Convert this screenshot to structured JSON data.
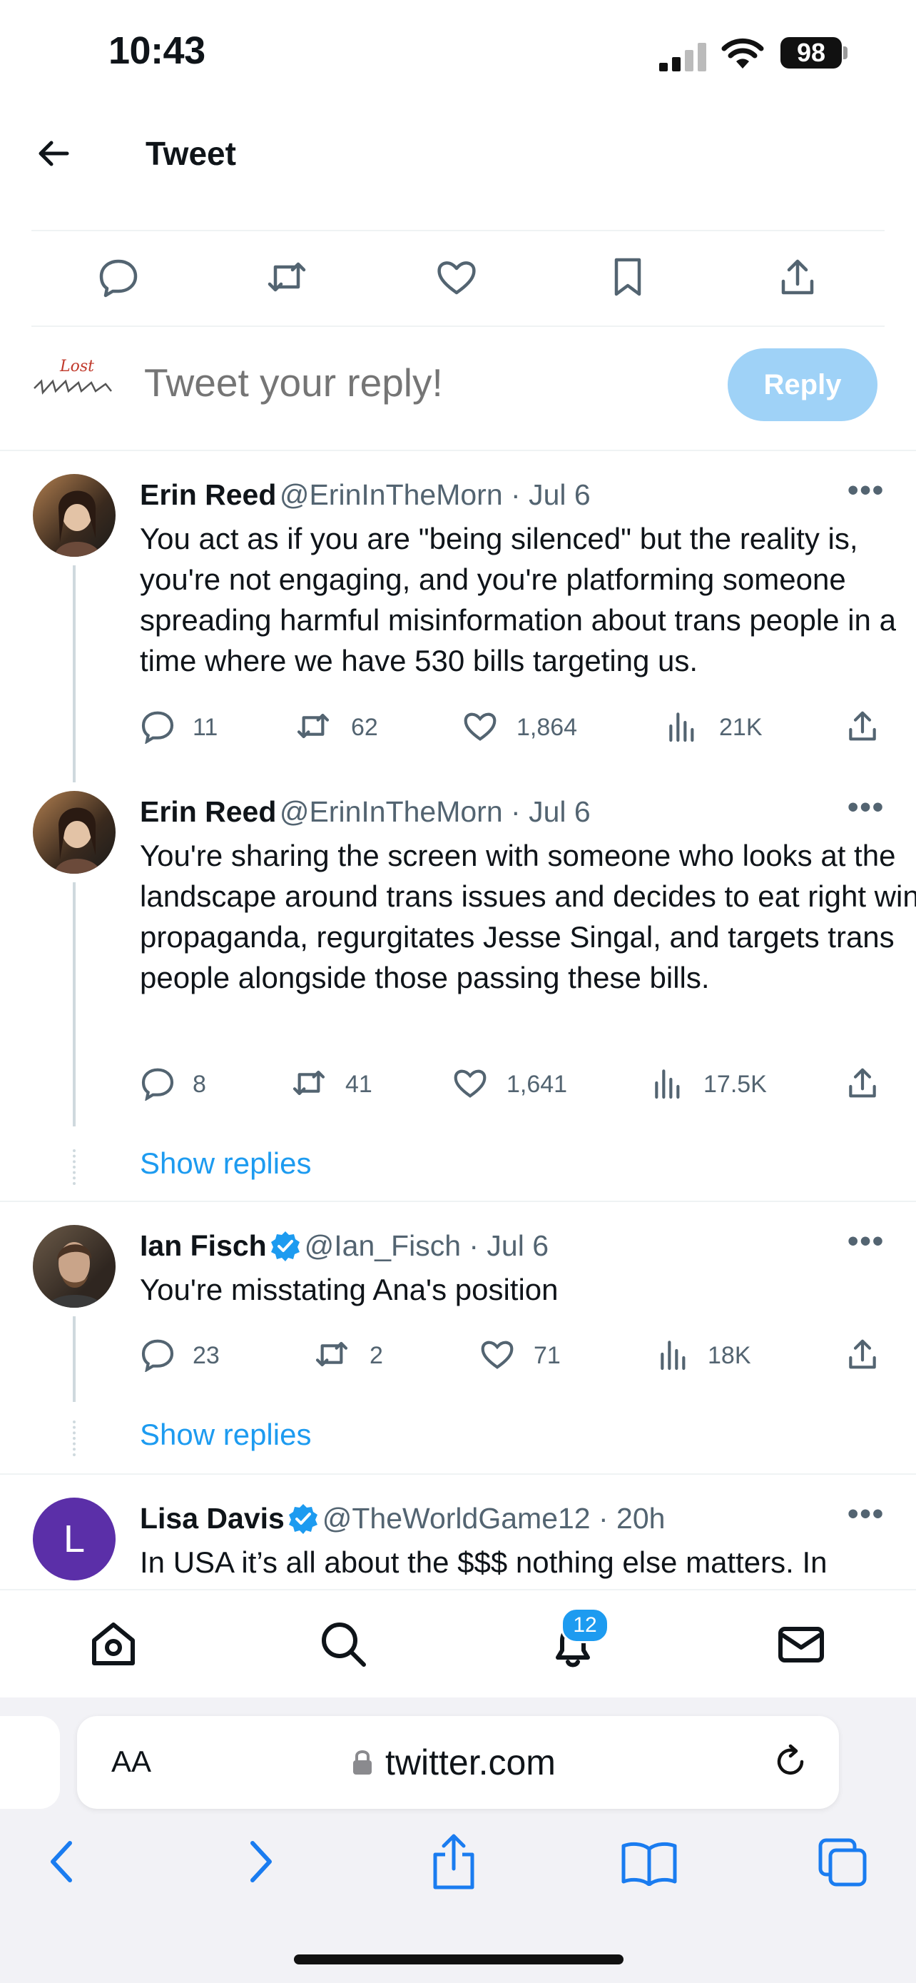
{
  "status_bar": {
    "time": "10:43",
    "battery": "98"
  },
  "header": {
    "title": "Tweet"
  },
  "composer": {
    "placeholder": "Tweet your reply!",
    "reply_label": "Reply",
    "avatar_text": "Lost"
  },
  "tweets": [
    {
      "name": "Erin Reed",
      "handle": "@ErinInTheMorn · Jul 6",
      "text": "You act as if you are \"being silenced\" but the reality is, you're not engaging, and you're platforming someone spreading harmful misinformation about trans people in a time where we have 530 bills targeting us.",
      "replies": "11",
      "retweets": "62",
      "likes": "1,864",
      "views": "21K"
    },
    {
      "name": "Erin Reed",
      "handle": "@ErinInTheMorn · Jul 6",
      "text": "You're sharing the screen with someone who looks at the landscape around trans issues and decides to eat right wing propaganda, regurgitates Jesse Singal, and targets trans people alongside those passing these bills.",
      "replies": "8",
      "retweets": "41",
      "likes": "1,641",
      "views": "17.5K",
      "show_replies": "Show replies"
    },
    {
      "name": "Ian Fisch",
      "handle": "@Ian_Fisch · Jul 6",
      "text": "You're misstating Ana's position",
      "replies": "23",
      "retweets": "2",
      "likes": "71",
      "views": "18K",
      "show_replies": "Show replies"
    },
    {
      "name": "Lisa Davis",
      "handle": "@TheWorldGame12 · 20h",
      "text": "In USA it’s all about the $$$ nothing else matters. In",
      "avatar_letter": "L"
    }
  ],
  "nav": {
    "notifications_badge": "12"
  },
  "browser": {
    "aa_label": "AA",
    "url": "twitter.com"
  },
  "colors": {
    "accent": "#1d9bf0",
    "reply_button": "#9fd2f7",
    "avatar_purple": "#5b2fa8"
  }
}
